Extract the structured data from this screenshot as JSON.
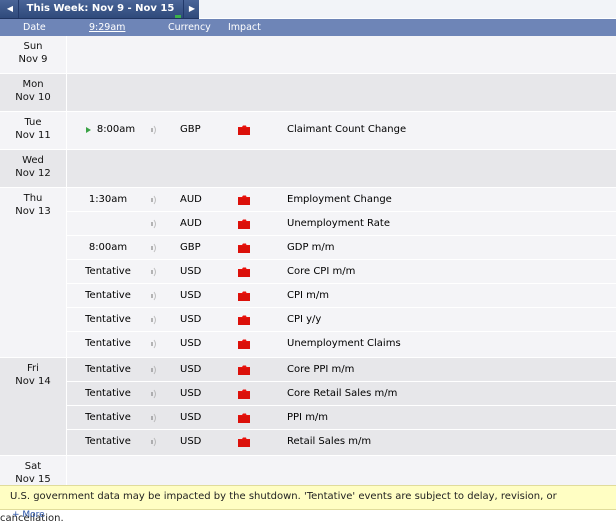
{
  "week_nav": {
    "title": "This Week: Nov 9 - Nov 15",
    "prev_icon": "chevron-left-icon",
    "next_icon": "chevron-right-icon"
  },
  "header": {
    "date": "Date",
    "time": "9:29am",
    "currency": "Currency",
    "impact": "Impact"
  },
  "impact_color": "#e8120c",
  "days": [
    {
      "weekday": "Sun",
      "date": "Nov 9",
      "events": []
    },
    {
      "weekday": "Mon",
      "date": "Nov 10",
      "events": []
    },
    {
      "weekday": "Tue",
      "date": "Nov 11",
      "events": [
        {
          "time": "8:00am",
          "next": true,
          "currency": "GBP",
          "impact": "high",
          "name": "Claimant Count Change"
        }
      ]
    },
    {
      "weekday": "Wed",
      "date": "Nov 12",
      "events": []
    },
    {
      "weekday": "Thu",
      "date": "Nov 13",
      "events": [
        {
          "time": "1:30am",
          "currency": "AUD",
          "impact": "high",
          "name": "Employment Change"
        },
        {
          "time": "",
          "currency": "AUD",
          "impact": "high",
          "name": "Unemployment Rate"
        },
        {
          "time": "8:00am",
          "currency": "GBP",
          "impact": "high",
          "name": "GDP m/m"
        },
        {
          "time": "Tentative",
          "currency": "USD",
          "impact": "high",
          "name": "Core CPI m/m"
        },
        {
          "time": "Tentative",
          "currency": "USD",
          "impact": "high",
          "name": "CPI m/m"
        },
        {
          "time": "Tentative",
          "currency": "USD",
          "impact": "high",
          "name": "CPI y/y"
        },
        {
          "time": "Tentative",
          "currency": "USD",
          "impact": "high",
          "name": "Unemployment Claims"
        }
      ]
    },
    {
      "weekday": "Fri",
      "date": "Nov 14",
      "events": [
        {
          "time": "Tentative",
          "currency": "USD",
          "impact": "high",
          "name": "Core PPI m/m"
        },
        {
          "time": "Tentative",
          "currency": "USD",
          "impact": "high",
          "name": "Core Retail Sales m/m"
        },
        {
          "time": "Tentative",
          "currency": "USD",
          "impact": "high",
          "name": "PPI m/m"
        },
        {
          "time": "Tentative",
          "currency": "USD",
          "impact": "high",
          "name": "Retail Sales m/m"
        }
      ]
    },
    {
      "weekday": "Sat",
      "date": "Nov 15",
      "events": []
    }
  ],
  "notice": "U.S. government data may be impacted by the shutdown. 'Tentative' events are subject to delay, revision, or cancellation.",
  "more_link": "+ More"
}
